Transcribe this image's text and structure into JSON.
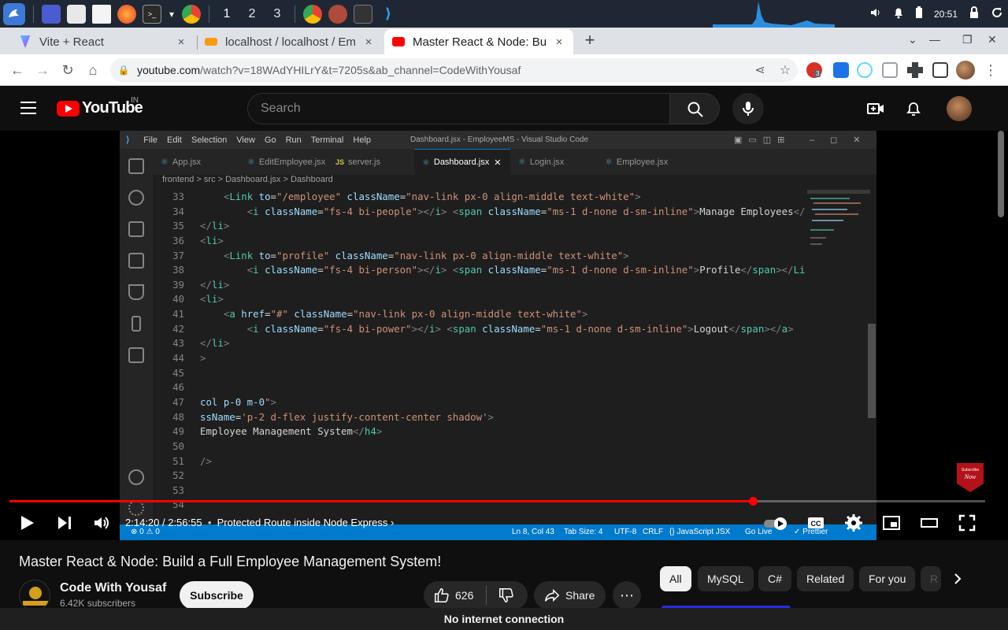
{
  "taskbar": {
    "workspaces": [
      "1",
      "2",
      "3"
    ],
    "clock": "20:51"
  },
  "browser": {
    "tabs": [
      {
        "title": "Vite + React",
        "close": "×"
      },
      {
        "title": "localhost / localhost / Emp",
        "close": "×"
      },
      {
        "title": "Master React & Node: Buil",
        "close": "×"
      }
    ],
    "new_tab": "+",
    "url_domain": "youtube.com",
    "url_path": "/watch?v=18WAdYHILrY&t=7205s&ab_channel=CodeWithYousaf",
    "ext_badge": "3"
  },
  "youtube": {
    "logo_text": "YouTube",
    "country": "IN",
    "search_placeholder": "Search"
  },
  "vscode": {
    "menu": [
      "File",
      "Edit",
      "Selection",
      "View",
      "Go",
      "Run",
      "Terminal",
      "Help"
    ],
    "window_title": "Dashboard.jsx - EmployeeMS - Visual Studio Code",
    "tabs": [
      {
        "name": "App.jsx",
        "icon": "react"
      },
      {
        "name": "EditEmployee.jsx",
        "icon": "react"
      },
      {
        "name": "server.js",
        "icon": "js"
      },
      {
        "name": "Dashboard.jsx",
        "icon": "react",
        "active": true
      },
      {
        "name": "Login.jsx",
        "icon": "react"
      },
      {
        "name": "Employee.jsx",
        "icon": "react"
      }
    ],
    "breadcrumb": "frontend > src > Dashboard.jsx > Dashboard",
    "code": [
      {
        "n": "33",
        "parts": [
          [
            "p",
            "    "
          ],
          [
            "punc",
            "<"
          ],
          [
            "tag",
            "Link"
          ],
          [
            "p",
            " "
          ],
          [
            "attr",
            "to"
          ],
          [
            "p",
            "="
          ],
          [
            "str",
            "\"/employee\""
          ],
          [
            "p",
            " "
          ],
          [
            "attr",
            "className"
          ],
          [
            "p",
            "="
          ],
          [
            "str",
            "\"nav-link px-0 align-middle text-white\""
          ],
          [
            "punc",
            ">"
          ]
        ]
      },
      {
        "n": "34",
        "parts": [
          [
            "p",
            "        "
          ],
          [
            "punc",
            "<"
          ],
          [
            "tag",
            "i"
          ],
          [
            "p",
            " "
          ],
          [
            "attr",
            "className"
          ],
          [
            "p",
            "="
          ],
          [
            "str",
            "\"fs-4 bi-people\""
          ],
          [
            "punc",
            "></"
          ],
          [
            "tag",
            "i"
          ],
          [
            "punc",
            "> <"
          ],
          [
            "tag",
            "span"
          ],
          [
            "p",
            " "
          ],
          [
            "attr",
            "className"
          ],
          [
            "p",
            "="
          ],
          [
            "str",
            "\"ms-1 d-none d-sm-inline\""
          ],
          [
            "punc",
            ">"
          ],
          [
            "p",
            "Manage Employees"
          ],
          [
            "punc",
            "</"
          ]
        ]
      },
      {
        "n": "35",
        "parts": [
          [
            "punc",
            "</"
          ],
          [
            "tag",
            "li"
          ],
          [
            "punc",
            ">"
          ]
        ]
      },
      {
        "n": "36",
        "parts": [
          [
            "punc",
            "<"
          ],
          [
            "tag",
            "li"
          ],
          [
            "punc",
            ">"
          ]
        ]
      },
      {
        "n": "37",
        "parts": [
          [
            "p",
            "    "
          ],
          [
            "punc",
            "<"
          ],
          [
            "tag",
            "Link"
          ],
          [
            "p",
            " "
          ],
          [
            "attr",
            "to"
          ],
          [
            "p",
            "="
          ],
          [
            "str",
            "\"profile\""
          ],
          [
            "p",
            " "
          ],
          [
            "attr",
            "className"
          ],
          [
            "p",
            "="
          ],
          [
            "str",
            "\"nav-link px-0 align-middle text-white\""
          ],
          [
            "punc",
            ">"
          ]
        ]
      },
      {
        "n": "38",
        "parts": [
          [
            "p",
            "        "
          ],
          [
            "punc",
            "<"
          ],
          [
            "tag",
            "i"
          ],
          [
            "p",
            " "
          ],
          [
            "attr",
            "className"
          ],
          [
            "p",
            "="
          ],
          [
            "str",
            "\"fs-4 bi-person\""
          ],
          [
            "punc",
            "></"
          ],
          [
            "tag",
            "i"
          ],
          [
            "punc",
            "> <"
          ],
          [
            "tag",
            "span"
          ],
          [
            "p",
            " "
          ],
          [
            "attr",
            "className"
          ],
          [
            "p",
            "="
          ],
          [
            "str",
            "\"ms-1 d-none d-sm-inline\""
          ],
          [
            "punc",
            ">"
          ],
          [
            "p",
            "Profile"
          ],
          [
            "punc",
            "</"
          ],
          [
            "tag",
            "span"
          ],
          [
            "punc",
            "></"
          ],
          [
            "tag",
            "Li"
          ]
        ]
      },
      {
        "n": "39",
        "parts": [
          [
            "punc",
            "</"
          ],
          [
            "tag",
            "li"
          ],
          [
            "punc",
            ">"
          ]
        ]
      },
      {
        "n": "40",
        "parts": [
          [
            "punc",
            "<"
          ],
          [
            "tag",
            "li"
          ],
          [
            "punc",
            ">"
          ]
        ]
      },
      {
        "n": "41",
        "parts": [
          [
            "p",
            "    "
          ],
          [
            "punc",
            "<"
          ],
          [
            "tag",
            "a"
          ],
          [
            "p",
            " "
          ],
          [
            "attr",
            "href"
          ],
          [
            "p",
            "="
          ],
          [
            "str",
            "\"#\""
          ],
          [
            "p",
            " "
          ],
          [
            "attr",
            "className"
          ],
          [
            "p",
            "="
          ],
          [
            "str",
            "\"nav-link px-0 align-middle text-white\""
          ],
          [
            "punc",
            ">"
          ]
        ]
      },
      {
        "n": "42",
        "parts": [
          [
            "p",
            "        "
          ],
          [
            "punc",
            "<"
          ],
          [
            "tag",
            "i"
          ],
          [
            "p",
            " "
          ],
          [
            "attr",
            "className"
          ],
          [
            "p",
            "="
          ],
          [
            "str",
            "\"fs-4 bi-power\""
          ],
          [
            "punc",
            "></"
          ],
          [
            "tag",
            "i"
          ],
          [
            "punc",
            "> <"
          ],
          [
            "tag",
            "span"
          ],
          [
            "p",
            " "
          ],
          [
            "attr",
            "className"
          ],
          [
            "p",
            "="
          ],
          [
            "str",
            "\"ms-1 d-none d-sm-inline\""
          ],
          [
            "punc",
            ">"
          ],
          [
            "p",
            "Logout"
          ],
          [
            "punc",
            "</"
          ],
          [
            "tag",
            "span"
          ],
          [
            "punc",
            "></"
          ],
          [
            "tag",
            "a"
          ],
          [
            "punc",
            ">"
          ]
        ]
      },
      {
        "n": "43",
        "parts": [
          [
            "punc",
            "</"
          ],
          [
            "tag",
            "li"
          ],
          [
            "punc",
            ">"
          ]
        ]
      },
      {
        "n": "44",
        "parts": [
          [
            "punc",
            ">"
          ]
        ]
      },
      {
        "n": "45",
        "parts": []
      },
      {
        "n": "46",
        "parts": []
      },
      {
        "n": "47",
        "parts": [
          [
            "attr",
            "col p-0 m-0"
          ],
          [
            "str",
            "\""
          ],
          [
            "punc",
            ">"
          ]
        ]
      },
      {
        "n": "48",
        "parts": [
          [
            "attr",
            "ssName"
          ],
          [
            "p",
            "="
          ],
          [
            "str",
            "'p-2 d-flex justify-content-center shadow'"
          ],
          [
            "punc",
            ">"
          ]
        ]
      },
      {
        "n": "49",
        "parts": [
          [
            "p",
            "Employee Management System"
          ],
          [
            "punc",
            "</"
          ],
          [
            "tag",
            "h4"
          ],
          [
            "punc",
            ">"
          ]
        ]
      },
      {
        "n": "50",
        "parts": []
      },
      {
        "n": "51",
        "parts": [
          [
            "punc",
            "/>"
          ]
        ]
      },
      {
        "n": "52",
        "parts": []
      },
      {
        "n": "53",
        "parts": []
      },
      {
        "n": "54",
        "parts": []
      }
    ],
    "status": {
      "left": "⊗ 0 ⚠ 0",
      "position": "Ln 8, Col 43",
      "tab_size": "Tab Size: 4",
      "encoding": "UTF-8",
      "eol": "CRLF",
      "language": "{} JavaScript JSX",
      "live": "Go Live",
      "prettier": "✓ Prettier"
    }
  },
  "player": {
    "progress_fraction": 0.762,
    "time": "2:14:20 / 2:56:55",
    "chapter": "Protected Route inside Node Express",
    "badge_top": "Subscribe",
    "badge_bottom": "Now"
  },
  "video": {
    "title": "Master React & Node: Build a Full Employee Management System!",
    "channel": "Code With Yousaf",
    "subscribers": "6.42K subscribers",
    "subscribe_label": "Subscribe",
    "likes": "626",
    "share_label": "Share",
    "more_label": "⋯"
  },
  "chips": [
    "All",
    "MySQL",
    "C#",
    "Related",
    "For you",
    "R"
  ],
  "offline_banner": "No internet connection"
}
